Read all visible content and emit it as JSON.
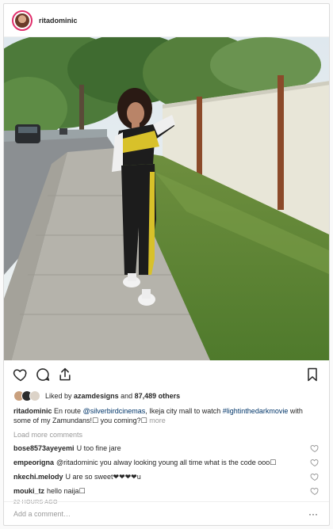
{
  "post": {
    "username": "ritadominic",
    "likes": {
      "prefix": "Liked by",
      "user": "azamdesigns",
      "joiner": "and",
      "count": "87,489 others"
    },
    "caption": {
      "user": "ritadominic",
      "text1": "En route ",
      "mention": "@silverbirdcinemas",
      "text2": ", Ikeja city mall to watch ",
      "hashtag": "#lightinthedarkmovie",
      "text3": " with some of my Zamundans!☐ you coming?☐",
      "more": "more"
    },
    "load_more": "Load more comments",
    "comments": [
      {
        "user": "bose8573ayeyemi",
        "text": "U too fine jare"
      },
      {
        "user": "empeorigna",
        "text": "@ritadominic you alway looking young all time what is the code ooo☐"
      },
      {
        "user": "nkechi.melody",
        "text": "U are so sweet❤❤❤❤u"
      },
      {
        "user": "mouki_tz",
        "text": "hello naija☐"
      }
    ],
    "timestamp": "22 HOURS AGO",
    "add_comment_placeholder": "Add a comment…",
    "options_glyph": "···"
  },
  "colors": {
    "story_ring": "#e1306c",
    "link": "#003569",
    "muted": "#999999",
    "border": "#dbdbdb"
  },
  "icons": [
    "heart-icon",
    "comment-icon",
    "share-icon",
    "bookmark-icon",
    "options-icon"
  ]
}
